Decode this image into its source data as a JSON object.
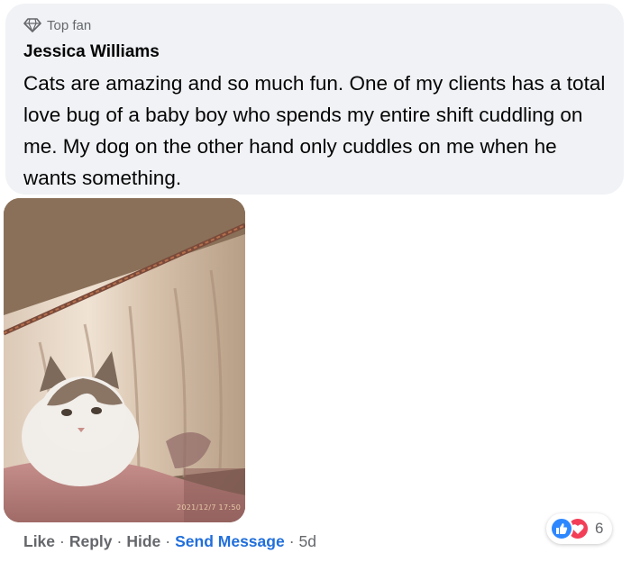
{
  "comment": {
    "badge": {
      "icon": "diamond-icon",
      "label": "Top fan"
    },
    "author": "Jessica Williams",
    "text": "Cats are amazing and so much fun. One of my clients has a total love bug of a baby boy who spends my entire shift cuddling on me. My dog on the other hand only cuddles on me when he wants something.",
    "photo": {
      "subject": "cat-photo",
      "timestamp": "2021/12/7 17:50"
    },
    "actions": {
      "like": "Like",
      "reply": "Reply",
      "hide": "Hide",
      "send_message": "Send Message",
      "time": "5d",
      "separator": "·"
    },
    "reactions": {
      "icons": [
        "like-icon",
        "love-icon"
      ],
      "count": "6"
    }
  },
  "colors": {
    "bubble_bg": "#f0f2f5",
    "secondary_text": "#65676b",
    "link_blue": "#216fdb",
    "like_blue": "#2d88ff",
    "love_red": "#f33e58"
  }
}
